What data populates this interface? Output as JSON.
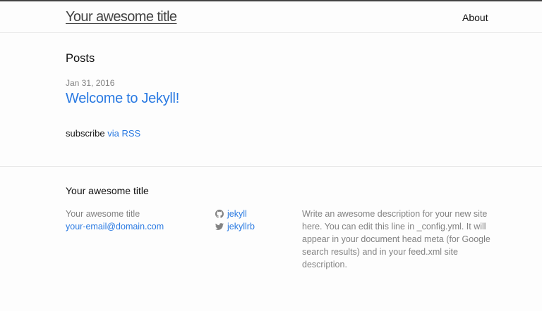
{
  "header": {
    "site_title": "Your awesome title",
    "nav_items": [
      {
        "label": "About"
      }
    ]
  },
  "main": {
    "heading": "Posts",
    "posts": [
      {
        "date": "Jan 31, 2016",
        "title": "Welcome to Jekyll!"
      }
    ],
    "rss": {
      "prefix": "subscribe",
      "link_label": "via RSS"
    }
  },
  "footer": {
    "heading": "Your awesome title",
    "contact": {
      "name": "Your awesome title",
      "email": "your-email@domain.com"
    },
    "social": [
      {
        "icon": "github-icon",
        "username": "jekyll"
      },
      {
        "icon": "twitter-icon",
        "username": "jekyllrb"
      }
    ],
    "description": "Write an awesome description for your new site here. You can edit this line in _config.yml. It will appear in your document head meta (for Google search results) and in your feed.xml site description."
  },
  "colors": {
    "link": "#2a7ae2",
    "muted": "#828282",
    "text": "#111111",
    "header_border": "#424242",
    "divider": "#e8e8e8",
    "background": "#fdfdfd"
  }
}
